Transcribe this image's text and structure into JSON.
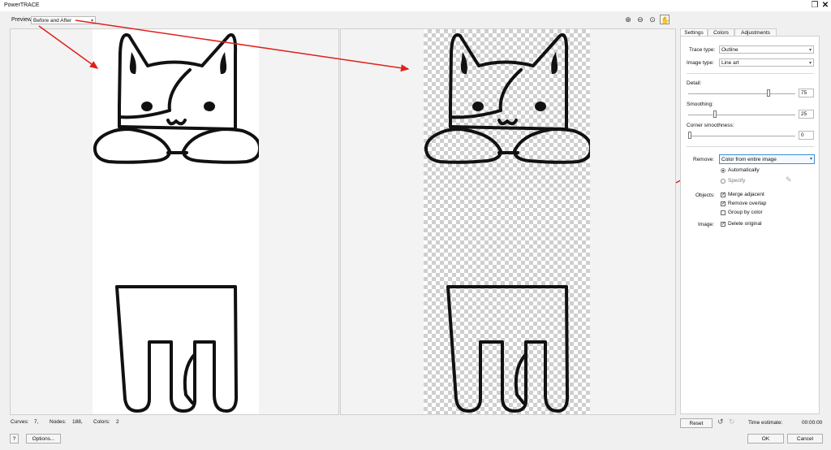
{
  "window": {
    "title": "PowerTRACE"
  },
  "preview": {
    "label": "Preview:",
    "mode": "Before and After"
  },
  "tabs": [
    {
      "label": "Settings"
    },
    {
      "label": "Colors"
    },
    {
      "label": "Adjustments"
    }
  ],
  "settings": {
    "trace_type": {
      "label": "Trace type:",
      "value": "Outline"
    },
    "image_type": {
      "label": "Image type:",
      "value": "Line art"
    },
    "detail": {
      "label": "Detail:",
      "value": "75"
    },
    "smoothing": {
      "label": "Smoothing:",
      "value": "25"
    },
    "corner_smoothness": {
      "label": "Corner smoothness:",
      "value": "0"
    },
    "remove": {
      "label": "Remove:",
      "value": "Color from entire image",
      "opt_auto": "Automatically",
      "opt_specify": "Specify"
    },
    "objects": {
      "label": "Objects:",
      "merge": "Merge adjacent",
      "overlap": "Remove overlap",
      "group": "Group by color"
    },
    "image": {
      "label": "Image:",
      "delete": "Delete original"
    }
  },
  "status": {
    "curves_label": "Curves:",
    "curves": "7,",
    "nodes_label": "Nodes:",
    "nodes": "188,",
    "colors_label": "Colors:",
    "colors": "2"
  },
  "bottom": {
    "help": "?",
    "options": "Options...",
    "reset": "Reset",
    "time_label": "Time estimate:",
    "time": "00:00:00",
    "ok": "OK",
    "cancel": "Cancel"
  }
}
